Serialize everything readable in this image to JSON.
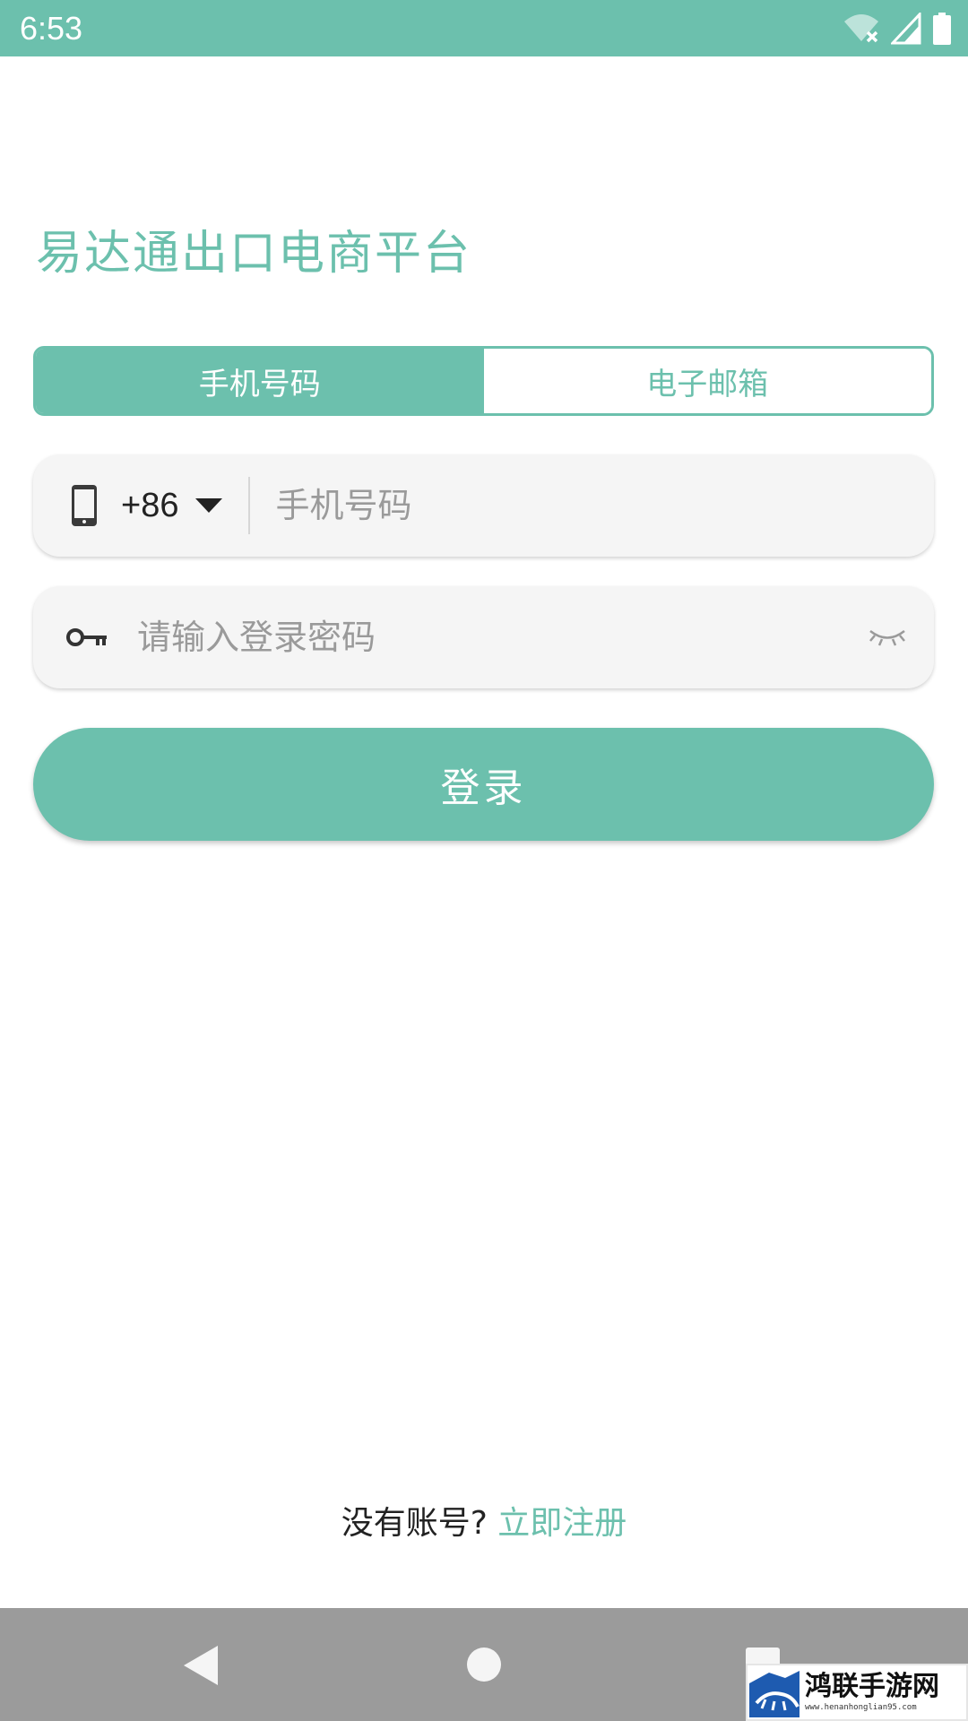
{
  "status_bar": {
    "time": "6:53",
    "icons": [
      "wifi-off-icon",
      "signal-icon",
      "battery-icon"
    ],
    "background": "#6cc0ad"
  },
  "app": {
    "title": "易达通出口电商平台",
    "accent_color": "#6cc0ad"
  },
  "tabs": [
    {
      "label": "手机号码",
      "active": true
    },
    {
      "label": "电子邮箱",
      "active": false
    }
  ],
  "phone_field": {
    "country_code": "+86",
    "placeholder": "手机号码",
    "value": "",
    "icon": "smartphone-icon"
  },
  "password_field": {
    "placeholder": "请输入登录密码",
    "value": "",
    "icon": "key-icon",
    "toggle_icon": "eye-closed-icon"
  },
  "login_button": {
    "label": "登录"
  },
  "register": {
    "prompt": "没有账号?",
    "link": "立即注册"
  },
  "nav_bar": {
    "buttons": [
      "back-icon",
      "home-icon",
      "recents-icon"
    ]
  },
  "watermark": {
    "title": "鸿联手游网",
    "url": "www.henanhonglian95.com"
  }
}
